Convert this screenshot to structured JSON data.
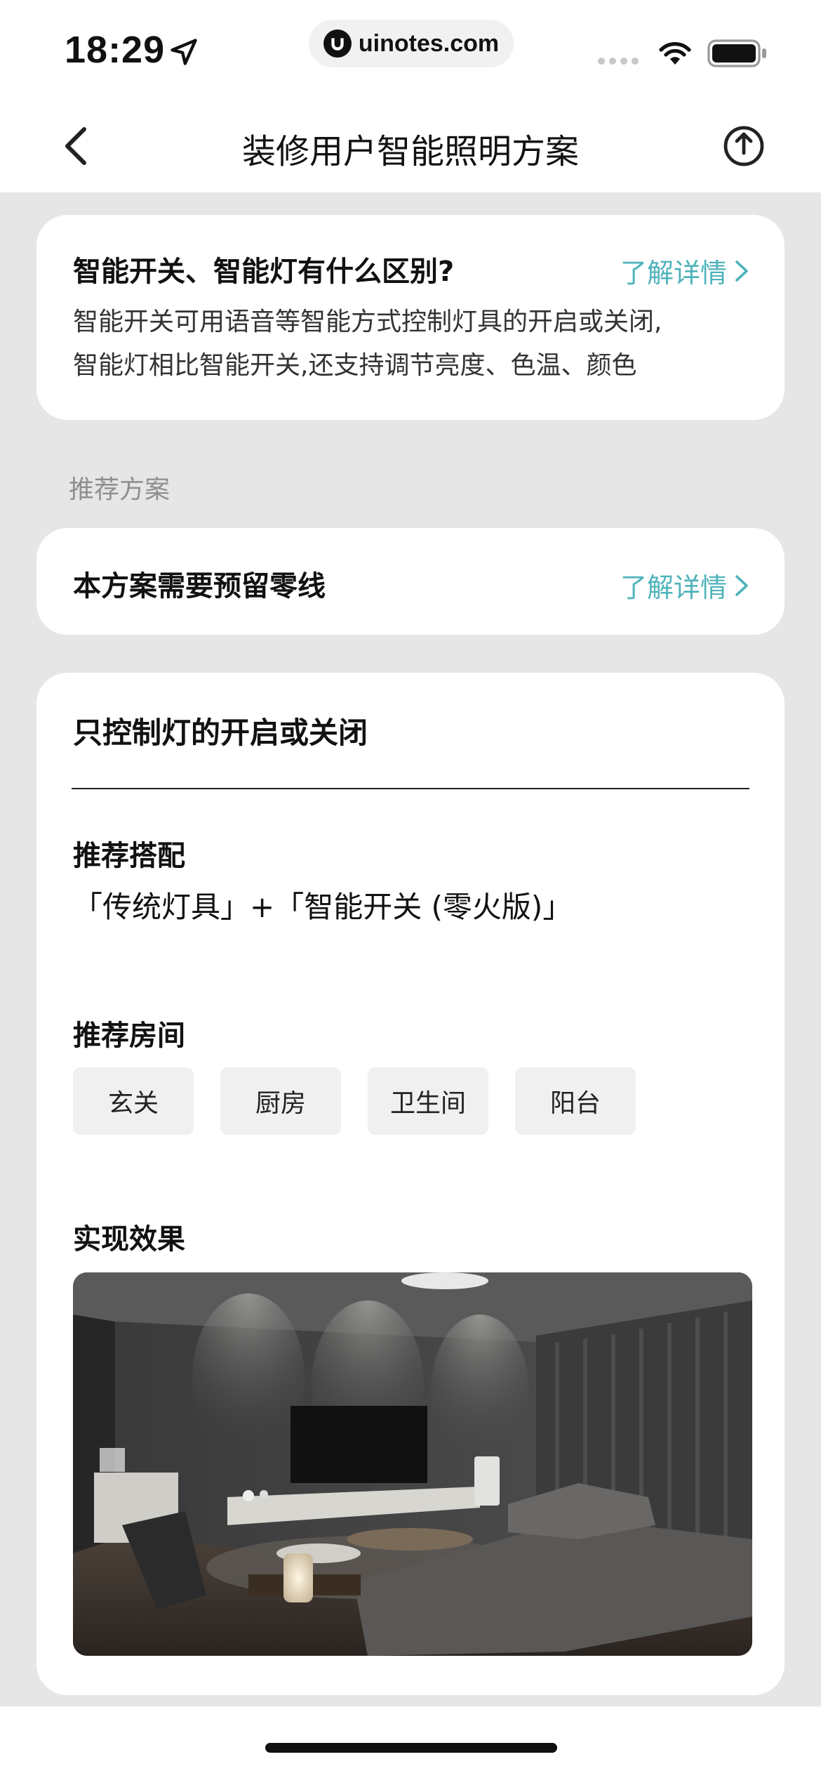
{
  "status_bar": {
    "time": "18:29",
    "url": "uinotes.com"
  },
  "nav": {
    "title": "装修用户智能照明方案"
  },
  "faq_card": {
    "title": "智能开关、智能灯有什么区别?",
    "link": "了解详情",
    "desc_line1": "智能开关可用语音等智能方式控制灯具的开启或关闭,",
    "desc_line2": "智能灯相比智能开关,还支持调节亮度、色温、颜色"
  },
  "section_label": "推荐方案",
  "neutral_card": {
    "title": "本方案需要预留零线",
    "link": "了解详情"
  },
  "plan": {
    "title": "只控制灯的开启或关闭",
    "combo_heading": "推荐搭配",
    "combo_text": "「传统灯具」+「智能开关 (零火版)」",
    "rooms_heading": "推荐房间",
    "rooms": [
      "玄关",
      "厨房",
      "卫生间",
      "阳台"
    ],
    "effect_heading": "实现效果"
  },
  "colors": {
    "accent": "#4fb3bb",
    "background": "#e6e6e6"
  }
}
